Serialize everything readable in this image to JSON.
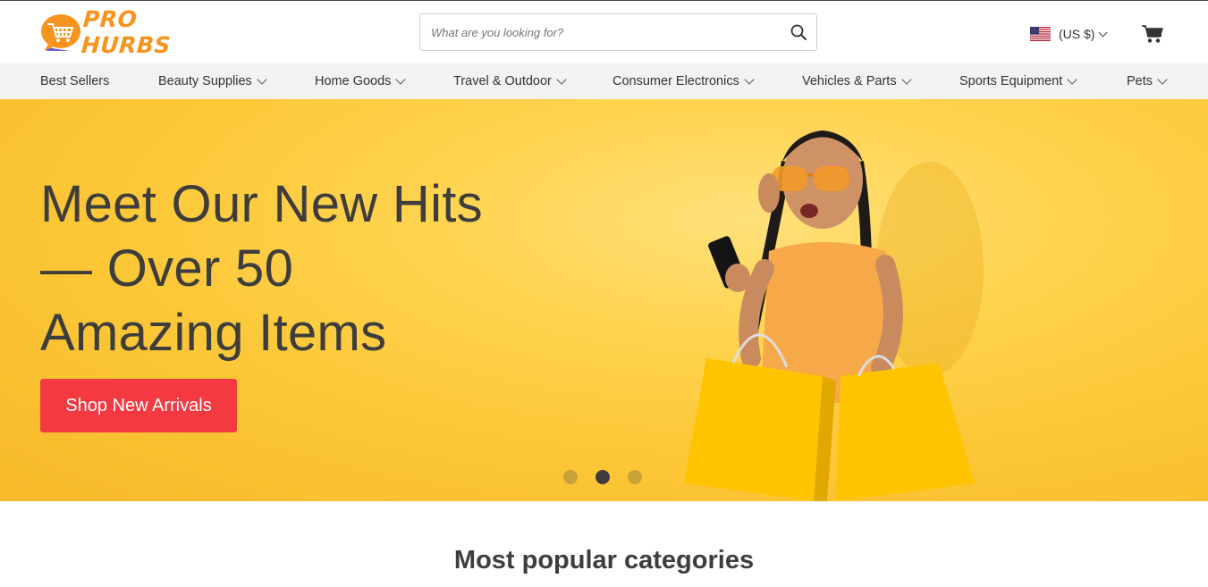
{
  "brand": {
    "name": "PRO HURBS",
    "color": "#f7941d"
  },
  "search": {
    "placeholder": "What are you looking for?",
    "value": ""
  },
  "header": {
    "currency_label": "(US $)",
    "flag_icon": "us-flag-icon",
    "cart_icon": "cart-icon"
  },
  "nav": {
    "items": [
      {
        "label": "Best Sellers",
        "has_dropdown": false
      },
      {
        "label": "Beauty Supplies",
        "has_dropdown": true
      },
      {
        "label": "Home Goods",
        "has_dropdown": true
      },
      {
        "label": "Travel & Outdoor",
        "has_dropdown": true
      },
      {
        "label": "Consumer Electronics",
        "has_dropdown": true
      },
      {
        "label": "Vehicles & Parts",
        "has_dropdown": true
      },
      {
        "label": "Sports Equipment",
        "has_dropdown": true
      },
      {
        "label": "Pets",
        "has_dropdown": true
      }
    ]
  },
  "hero": {
    "title": "Meet Our New Hits\n— Over 50\nAmazing Items",
    "cta_label": "Shop New Arrivals",
    "cta_color": "#f43a40",
    "background_color": "#fcc737",
    "slides_total": 3,
    "active_slide": 2
  },
  "section": {
    "title": "Most popular categories"
  }
}
